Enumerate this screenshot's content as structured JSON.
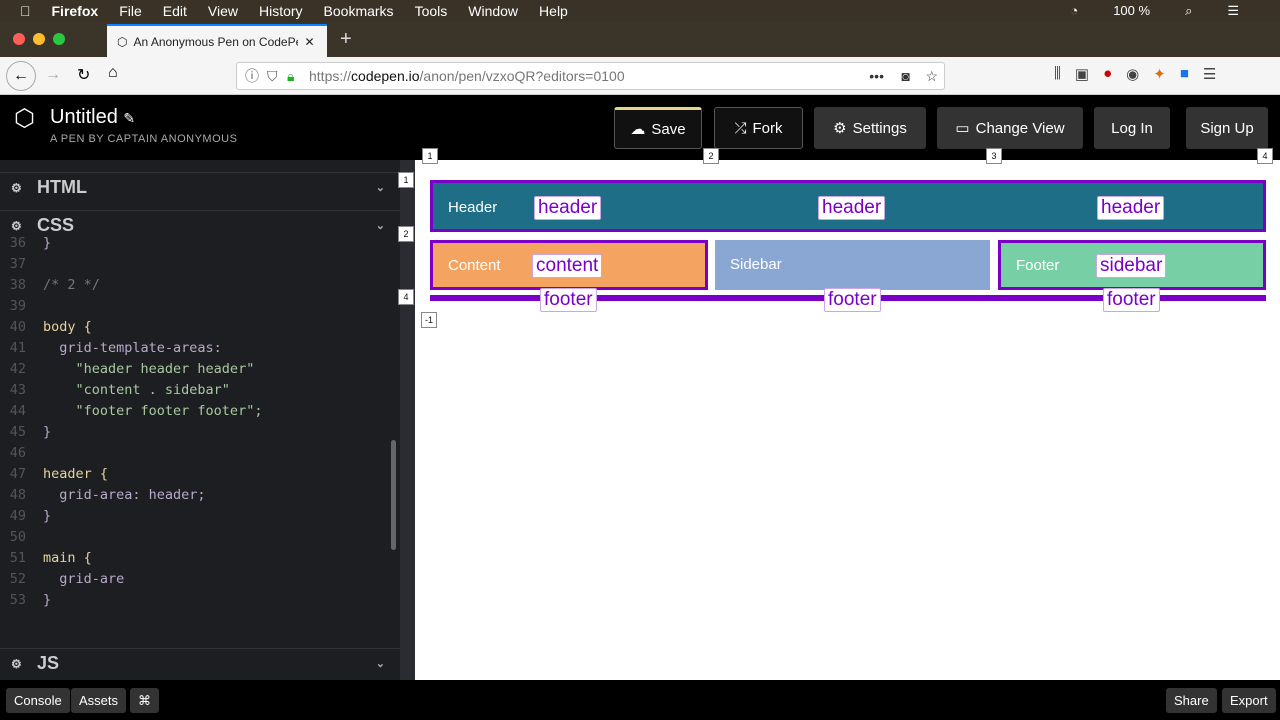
{
  "menubar": {
    "app": "Firefox",
    "items": [
      "File",
      "Edit",
      "View",
      "History",
      "Bookmarks",
      "Tools",
      "Window",
      "Help"
    ],
    "battery": "100 %"
  },
  "browser": {
    "tab_title": "An Anonymous Pen on CodePen",
    "url_prefix": "https://",
    "url_host": "codepen.io",
    "url_path": "/anon/pen/vzxoQR?editors=0100"
  },
  "codepen": {
    "title": "Untitled",
    "subtitle": "A PEN BY CAPTAIN ANONYMOUS",
    "buttons": {
      "save": "Save",
      "fork": "Fork",
      "settings": "Settings",
      "change_view": "Change View",
      "login": "Log In",
      "signup": "Sign Up"
    }
  },
  "editor": {
    "panes": {
      "html": "HTML",
      "css": "CSS",
      "js": "JS"
    },
    "lines": [
      {
        "n": "36",
        "t": "}"
      },
      {
        "n": "37",
        "t": ""
      },
      {
        "n": "38",
        "t": "/* 2 */"
      },
      {
        "n": "39",
        "t": ""
      },
      {
        "n": "40",
        "t": "body {"
      },
      {
        "n": "41",
        "t": "  grid-template-areas:"
      },
      {
        "n": "42",
        "t": "    \"header header header\""
      },
      {
        "n": "43",
        "t": "    \"content . sidebar\""
      },
      {
        "n": "44",
        "t": "    \"footer footer footer\";"
      },
      {
        "n": "45",
        "t": "}"
      },
      {
        "n": "46",
        "t": ""
      },
      {
        "n": "47",
        "t": "header {"
      },
      {
        "n": "48",
        "t": "  grid-area: header;"
      },
      {
        "n": "49",
        "t": "}"
      },
      {
        "n": "50",
        "t": ""
      },
      {
        "n": "51",
        "t": "main {"
      },
      {
        "n": "52",
        "t": "  grid-are"
      },
      {
        "n": "53",
        "t": "}"
      }
    ]
  },
  "preview": {
    "header": "Header",
    "content": "Content",
    "sidebar": "Sidebar",
    "footer": "Footer",
    "area_labels_row1": [
      "header",
      "header",
      "header"
    ],
    "area_labels_row2": [
      "content",
      "sidebar"
    ],
    "area_labels_row3": [
      "footer",
      "footer",
      "footer"
    ],
    "col_lines": [
      "1",
      "2",
      "3",
      "4"
    ],
    "row_lines": [
      "1",
      "2",
      "4"
    ],
    "neg_line": "-1",
    "colors": {
      "header": "#1e6e87",
      "content": "#f4a460",
      "sidebar": "#8aa6d2",
      "footer": "#77cfa5",
      "grid": "#7a00c8"
    }
  },
  "bottombar": {
    "console": "Console",
    "assets": "Assets",
    "shortcut": "⌘",
    "share": "Share",
    "export": "Export"
  }
}
